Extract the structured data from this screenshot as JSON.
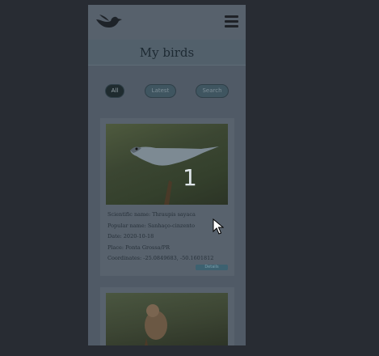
{
  "header": {
    "logo_icon": "bird-logo-icon",
    "menu_icon": "hamburger-menu-icon"
  },
  "page": {
    "title": "My birds"
  },
  "filters": [
    {
      "label": "All",
      "active": true
    },
    {
      "label": "Latest",
      "active": false
    },
    {
      "label": "Search",
      "active": false
    }
  ],
  "cards": [
    {
      "scientific": "Scientific name: Thraupis sayaca",
      "popular": "Popular name: Sanhaço-cinzento",
      "date": "Date: 2020-10-18",
      "place": "Place: Ponta Grossa/PR",
      "coords": "Coordinates: -25.0849683, -50.1601812",
      "edit_label": "Details"
    }
  ],
  "overlay": {
    "step": "1"
  }
}
